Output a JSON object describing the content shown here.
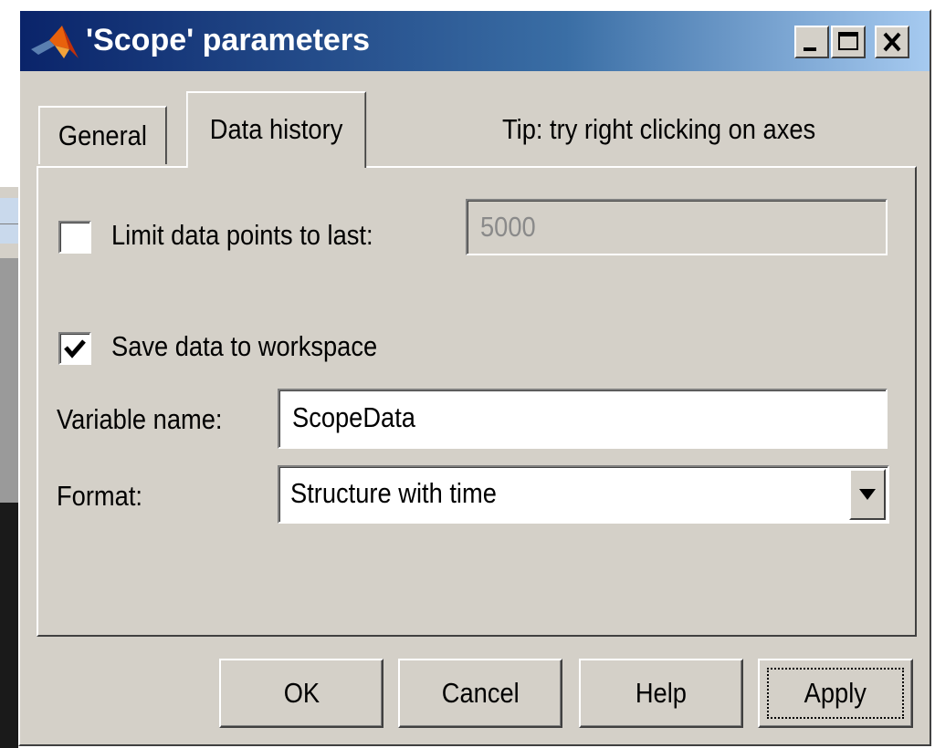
{
  "window": {
    "title": "'Scope' parameters",
    "icon": "matlab-logo-icon",
    "controls": [
      "minimize-icon",
      "maximize-icon",
      "close-icon"
    ]
  },
  "tabs": [
    {
      "label": "General",
      "active": false
    },
    {
      "label": "Data history",
      "active": true
    }
  ],
  "tip": "Tip: try right clicking on axes",
  "form": {
    "limit": {
      "label": "Limit data points to last:",
      "checked": false,
      "value": "5000"
    },
    "save": {
      "label": "Save data to workspace",
      "checked": true
    },
    "variable": {
      "label": "Variable name:",
      "value": "ScopeData"
    },
    "format": {
      "label": "Format:",
      "selected": "Structure with time"
    }
  },
  "buttons": {
    "ok": "OK",
    "cancel": "Cancel",
    "help": "Help",
    "apply": "Apply"
  },
  "colors": {
    "titlebar_start": "#0a246a",
    "titlebar_end": "#a6caf0",
    "dialog_face": "#d4d0c8"
  }
}
